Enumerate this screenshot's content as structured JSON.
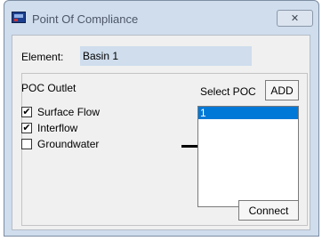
{
  "window": {
    "title": "Point Of Compliance",
    "close_glyph": "✕"
  },
  "element": {
    "label": "Element:",
    "value": "Basin 1"
  },
  "poc_outlet": {
    "title": "POC Outlet",
    "options": [
      {
        "label": "Surface Flow",
        "checked": true
      },
      {
        "label": "Interflow",
        "checked": true
      },
      {
        "label": "Groundwater",
        "checked": false
      }
    ]
  },
  "select_poc": {
    "label": "Select POC",
    "add_label": "ADD",
    "items": [
      "1"
    ]
  },
  "connect_label": "Connect",
  "colors": {
    "selection": "#0078d7",
    "frame": "#cfdded"
  },
  "icons": [
    "app-icon",
    "close-icon"
  ]
}
